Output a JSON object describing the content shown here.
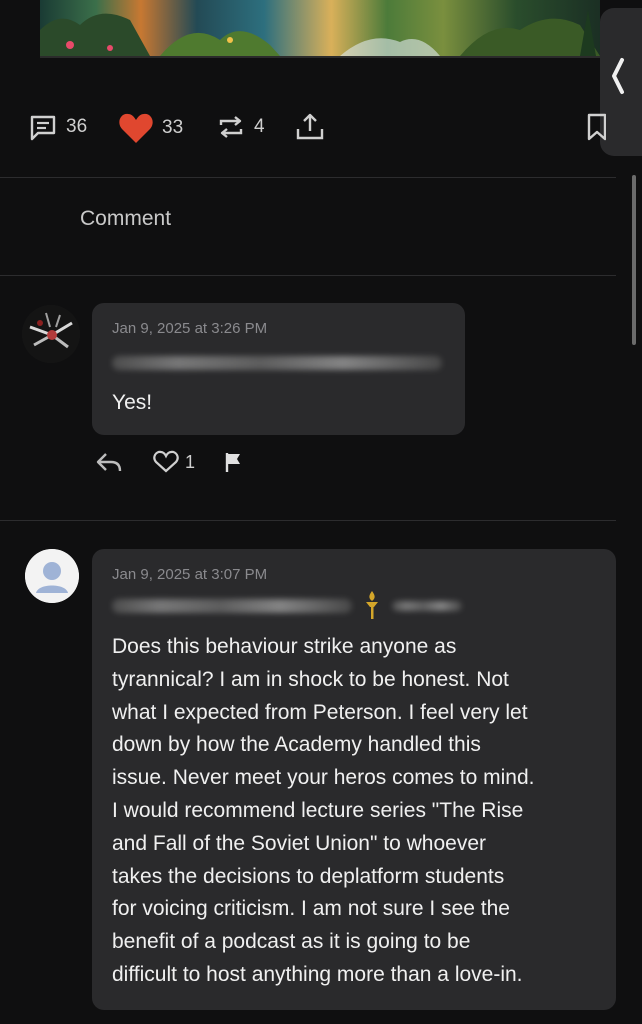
{
  "post": {
    "stats": {
      "comments": "36",
      "likes": "33",
      "reposts": "4"
    },
    "comment_placeholder": "Comment"
  },
  "comments": [
    {
      "timestamp": "Jan 9, 2025 at 3:26 PM",
      "text": "Yes!",
      "likes": "1"
    },
    {
      "timestamp": "Jan 9, 2025 at 3:07 PM",
      "lines": [
        "Does this behaviour strike anyone as",
        "tyrannical? I am in shock to be honest. Not",
        "what I expected from Peterson. I feel very let",
        "down by how the Academy handled this",
        "issue. Never meet your heros comes to mind.",
        "I would recommend lecture series \"The Rise",
        "and Fall of the Soviet Union\" to whoever",
        "takes the decisions to deplatform students",
        "for voicing criticism. I am not sure I see the",
        "benefit of a podcast as it is going to be",
        "difficult to host anything more than a love-in."
      ]
    }
  ],
  "icons": {
    "comment": "comment-icon",
    "heart": "heart-icon",
    "repost": "repost-icon",
    "share": "share-icon",
    "bookmark": "bookmark-icon",
    "reply": "reply-icon",
    "flag": "flag-icon",
    "badge": "torch-badge-icon"
  },
  "colors": {
    "like_active": "#e0472f",
    "background": "#0f0f10",
    "bubble": "#2a2a2c",
    "badge": "#d4a62a"
  }
}
